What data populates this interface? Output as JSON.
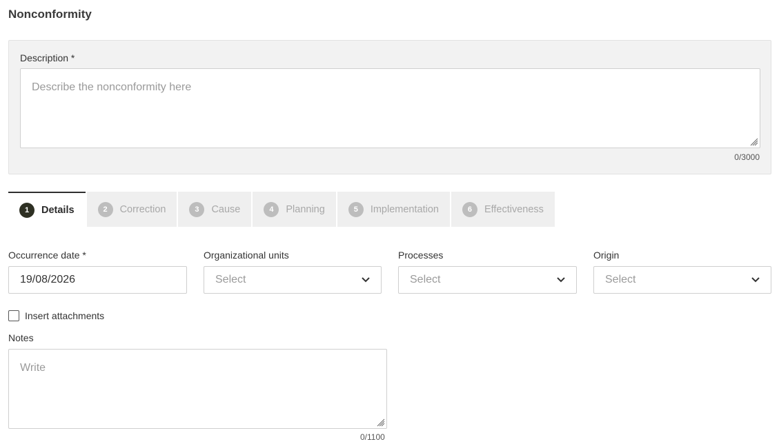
{
  "page": {
    "title": "Nonconformity"
  },
  "description": {
    "label": "Description *",
    "placeholder": "Describe the nonconformity here",
    "counter": "0/3000"
  },
  "tabs": [
    {
      "number": "1",
      "label": "Details",
      "active": true
    },
    {
      "number": "2",
      "label": "Correction",
      "active": false
    },
    {
      "number": "3",
      "label": "Cause",
      "active": false
    },
    {
      "number": "4",
      "label": "Planning",
      "active": false
    },
    {
      "number": "5",
      "label": "Implementation",
      "active": false
    },
    {
      "number": "6",
      "label": "Effectiveness",
      "active": false
    }
  ],
  "fields": {
    "occurrence_date": {
      "label": "Occurrence date *",
      "value": "19/08/2026"
    },
    "org_units": {
      "label": "Organizational units",
      "placeholder": "Select"
    },
    "processes": {
      "label": "Processes",
      "placeholder": "Select"
    },
    "origin": {
      "label": "Origin",
      "placeholder": "Select"
    }
  },
  "attachments": {
    "label": "Insert attachments",
    "checked": false
  },
  "notes": {
    "label": "Notes",
    "placeholder": "Write",
    "counter": "0/1100"
  },
  "icons": {
    "dropdown": "chevron-down-icon",
    "grip": "resize-grip-icon"
  },
  "colors": {
    "active_tab_badge": "#2e3023",
    "panel_bg": "#f2f2f2"
  }
}
